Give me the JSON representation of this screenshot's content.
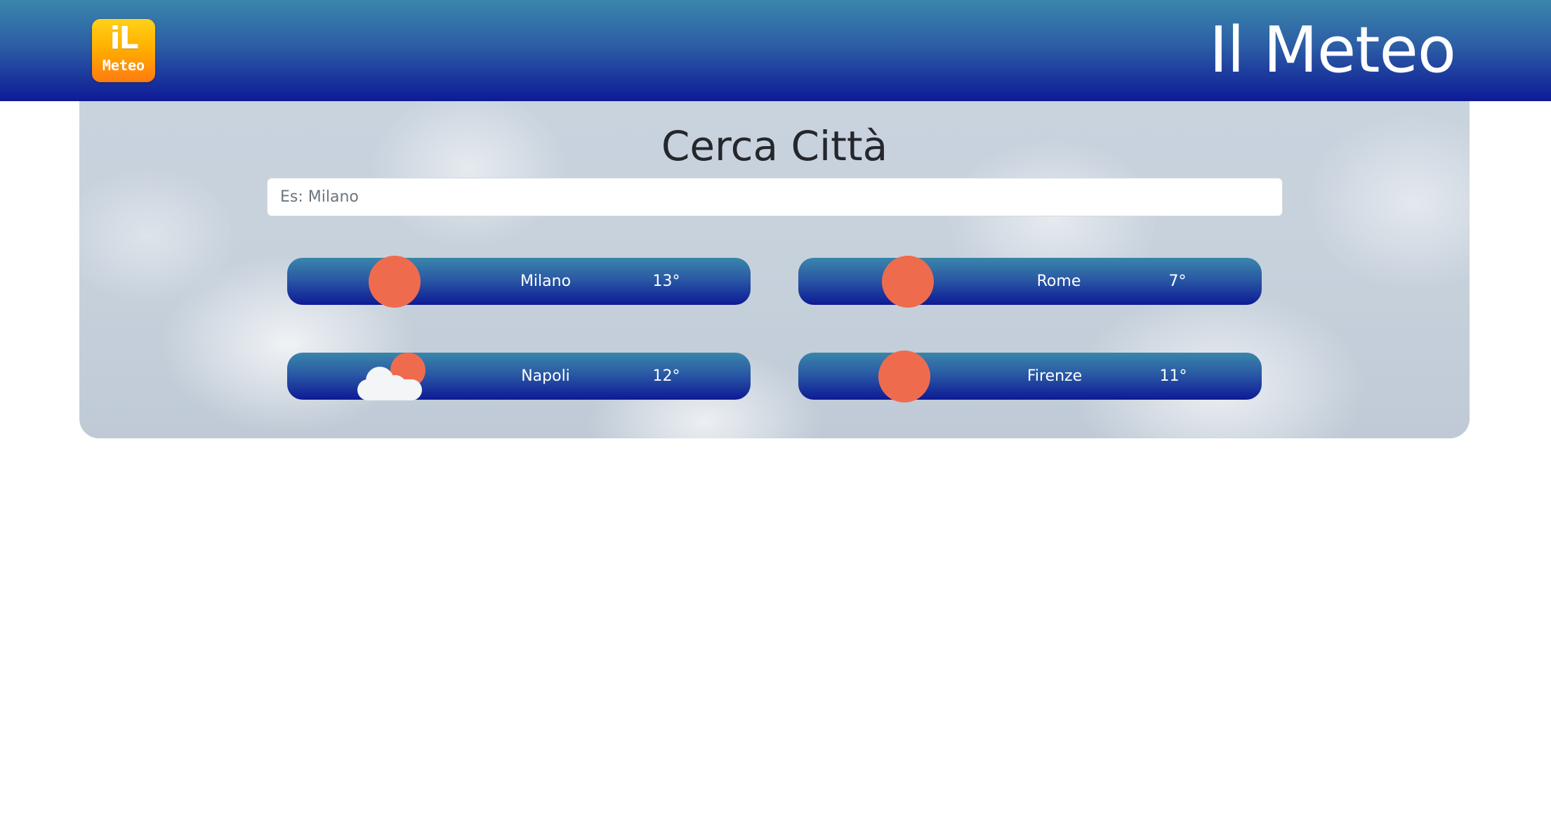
{
  "header": {
    "logo_top": "iL",
    "logo_bottom": "Meteo",
    "title": "Il Meteo"
  },
  "search": {
    "title": "Cerca Città",
    "placeholder": "Es: Milano",
    "value": ""
  },
  "cities": [
    {
      "name": "Milano",
      "temp": "13°",
      "icon": "sun-icon"
    },
    {
      "name": "Rome",
      "temp": "7°",
      "icon": "sun-icon"
    },
    {
      "name": "Napoli",
      "temp": "12°",
      "icon": "partly-cloudy-icon"
    },
    {
      "name": "Firenze",
      "temp": "11°",
      "icon": "sun-icon"
    }
  ],
  "colors": {
    "header_gradient_top": "#3a86ab",
    "header_gradient_bottom": "#0e1a96",
    "sun": "#ee6c4d",
    "logo_orange": "#ff7a10"
  }
}
